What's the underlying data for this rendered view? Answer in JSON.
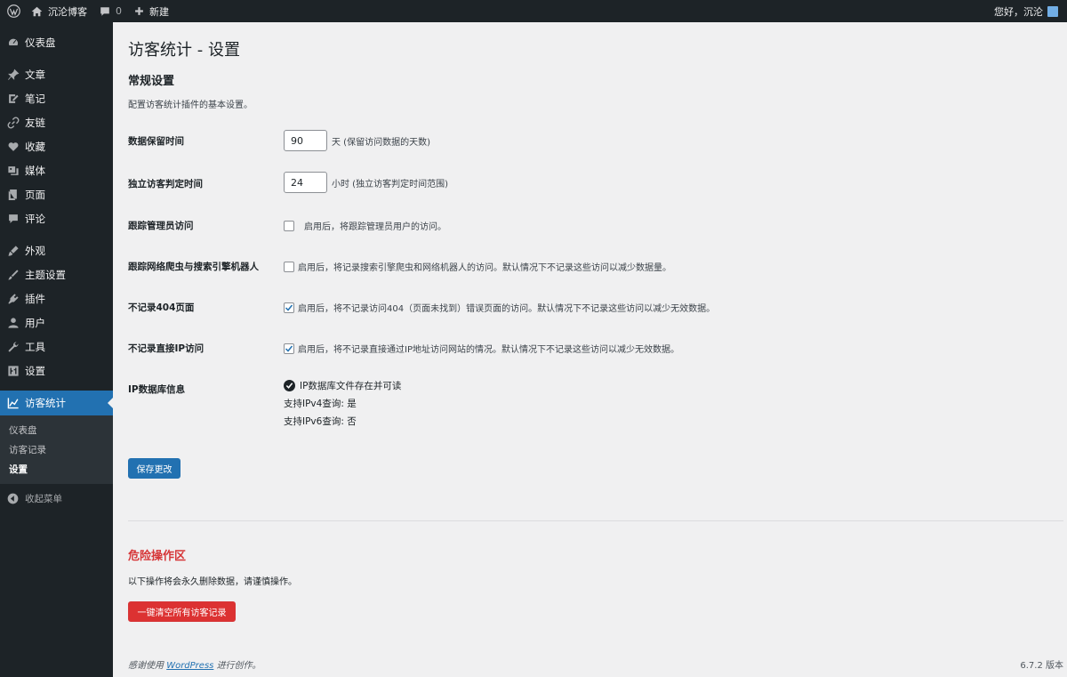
{
  "adminbar": {
    "site_name": "沉沦博客",
    "comments_count": "0",
    "new_label": "新建",
    "greeting": "您好，沉沦"
  },
  "sidebar": {
    "items": [
      {
        "label": "仪表盘",
        "icon": "dashboard-icon"
      },
      {
        "label": "文章",
        "icon": "pin-icon"
      },
      {
        "label": "笔记",
        "icon": "note-icon"
      },
      {
        "label": "友链",
        "icon": "link-icon"
      },
      {
        "label": "收藏",
        "icon": "heart-icon"
      },
      {
        "label": "媒体",
        "icon": "media-icon"
      },
      {
        "label": "页面",
        "icon": "page-icon"
      },
      {
        "label": "评论",
        "icon": "comment-icon"
      },
      {
        "label": "外观",
        "icon": "brush-icon"
      },
      {
        "label": "主题设置",
        "icon": "brush-icon"
      },
      {
        "label": "插件",
        "icon": "plugin-icon"
      },
      {
        "label": "用户",
        "icon": "user-icon"
      },
      {
        "label": "工具",
        "icon": "wrench-icon"
      },
      {
        "label": "设置",
        "icon": "settings-icon"
      },
      {
        "label": "访客统计",
        "icon": "chart-line-icon"
      }
    ],
    "submenu": [
      "仪表盘",
      "访客记录",
      "设置"
    ],
    "collapse_label": "收起菜单"
  },
  "page": {
    "title": "访客统计 - 设置",
    "section_title": "常规设置",
    "section_desc": "配置访客统计插件的基本设置。"
  },
  "settings": {
    "retention_label": "数据保留时间",
    "retention_value": "90",
    "retention_unit": "天 (保留访问数据的天数)",
    "unique_label": "独立访客判定时间",
    "unique_value": "24",
    "unique_unit": "小时 (独立访客判定时间范围)",
    "track_admin_label": "跟踪管理员访问",
    "track_admin_desc": "启用后，将跟踪管理员用户的访问。",
    "track_bots_label": "跟踪网络爬虫与搜索引擎机器人",
    "track_bots_desc": "启用后，将记录搜索引擎爬虫和网络机器人的访问。默认情况下不记录这些访问以减少数据量。",
    "no404_label": "不记录404页面",
    "no404_desc": "启用后，将不记录访问404（页面未找到）错误页面的访问。默认情况下不记录这些访问以减少无效数据。",
    "noip_label": "不记录直接IP访问",
    "noip_desc": "启用后，将不记录直接通过IP地址访问网站的情况。默认情况下不记录这些访问以减少无效数据。",
    "ipdb_label": "IP数据库信息",
    "ipdb_status": "IP数据库文件存在并可读",
    "ipv4_support": "支持IPv4查询: 是",
    "ipv6_support": "支持IPv6查询: 否",
    "save_label": "保存更改"
  },
  "danger": {
    "title": "危险操作区",
    "desc": "以下操作将会永久删除数据，请谨慎操作。",
    "clear_label": "一键清空所有访客记录"
  },
  "footer": {
    "thanks_prefix": "感谢使用",
    "wp_link": "WordPress",
    "thanks_suffix": "进行创作。",
    "version": "6.7.2 版本"
  }
}
